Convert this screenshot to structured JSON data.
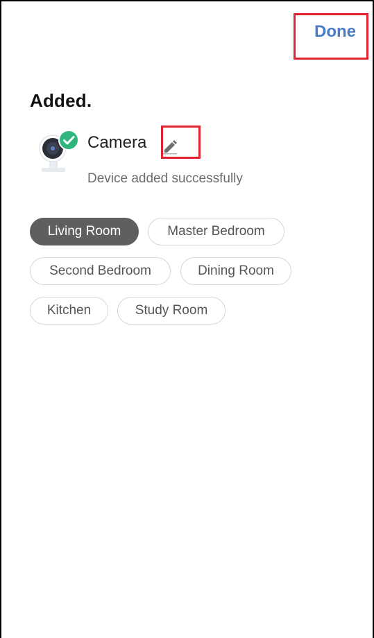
{
  "header": {
    "done_label": "Done"
  },
  "page": {
    "title": "Added."
  },
  "device": {
    "icon": "camera-icon",
    "name": "Camera",
    "status": "Device added successfully",
    "edit_icon": "pencil-icon",
    "success_badge_icon": "check-circle-icon"
  },
  "rooms": {
    "selected": "Living Room",
    "items": [
      "Living Room",
      "Master Bedroom",
      "Second Bedroom",
      "Dining Room",
      "Kitchen",
      "Study Room"
    ]
  },
  "colors": {
    "accent": "#4a7dc6",
    "success": "#2fb67d",
    "selected_chip": "#5f5f5f",
    "highlight": "#e0232e"
  }
}
